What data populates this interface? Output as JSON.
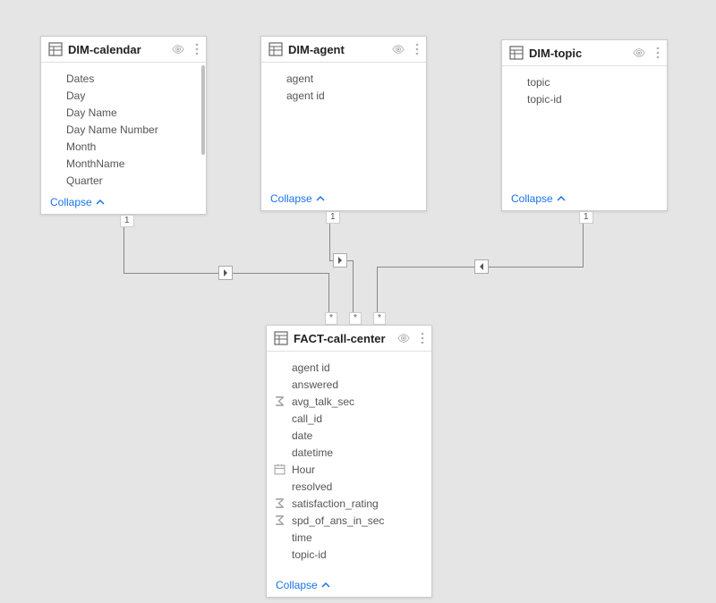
{
  "tables": {
    "dim_calendar": {
      "title": "DIM-calendar",
      "collapse": "Collapse",
      "fields": [
        "Dates",
        "Day",
        "Day Name",
        "Day Name Number",
        "Month",
        "MonthName",
        "Quarter"
      ]
    },
    "dim_agent": {
      "title": "DIM-agent",
      "collapse": "Collapse",
      "fields": [
        "agent",
        "agent id"
      ]
    },
    "dim_topic": {
      "title": "DIM-topic",
      "collapse": "Collapse",
      "fields": [
        "topic",
        "topic-id"
      ]
    },
    "fact_call_center": {
      "title": "FACT-call-center",
      "collapse": "Collapse",
      "fields": [
        "agent id",
        "answered",
        "avg_talk_sec",
        "call_id",
        "date",
        "datetime",
        "Hour",
        "resolved",
        "satisfaction_rating",
        "spd_of_ans_in_sec",
        "time",
        "topic-id"
      ]
    }
  },
  "relationships": {
    "one": "1",
    "many": "*"
  }
}
